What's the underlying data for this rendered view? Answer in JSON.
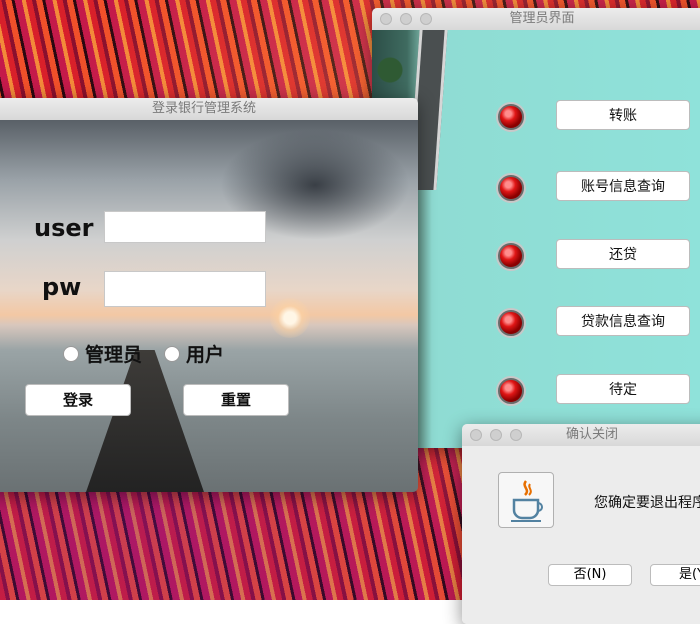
{
  "admin_window": {
    "title": "管理员界面",
    "buttons": [
      {
        "label": "转账"
      },
      {
        "label": "账号信息查询"
      },
      {
        "label": "还贷"
      },
      {
        "label": "贷款信息查询"
      },
      {
        "label": "待定"
      }
    ]
  },
  "login_window": {
    "title": "登录银行管理系统",
    "user_label": "user",
    "pw_label": "pw",
    "user_value": "",
    "pw_value": "",
    "role_admin": "管理员",
    "role_user": "用户",
    "login_button": "登录",
    "reset_button": "重置"
  },
  "confirm_dialog": {
    "title": "确认关闭",
    "message": "您确定要退出程序",
    "no_button": "否(N)",
    "yes_button": "是(Y"
  },
  "colors": {
    "led_red": "#e01616",
    "titlebar_text": "#7a7a7a"
  },
  "icons": {
    "dialog_icon": "java-icon"
  }
}
